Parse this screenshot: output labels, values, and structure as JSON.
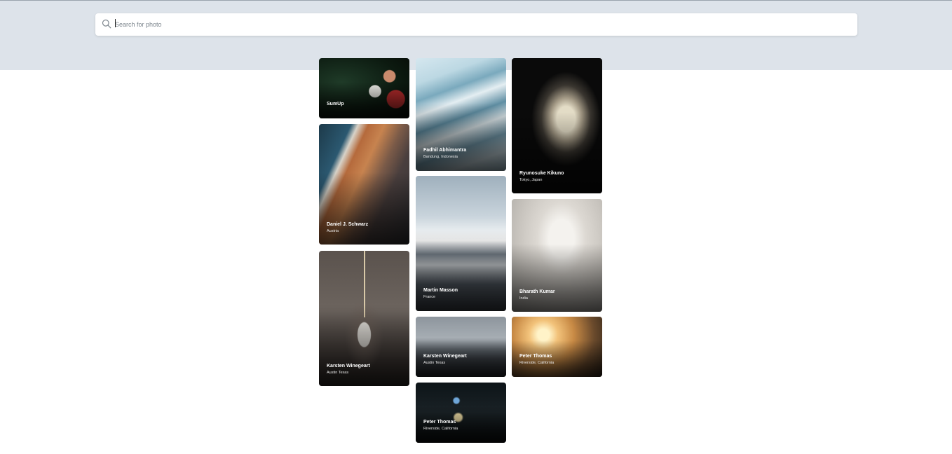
{
  "search": {
    "placeholder": "Search for photo",
    "value": ""
  },
  "photos": [
    {
      "name": "SumUp",
      "location": ""
    },
    {
      "name": "Daniel J. Schwarz",
      "location": "Austria"
    },
    {
      "name": "Karsten Winegeart",
      "location": "Austin Texas"
    },
    {
      "name": "Fadhil Abhimantra",
      "location": "Bandung, Indonesia"
    },
    {
      "name": "Martin Masson",
      "location": "France"
    },
    {
      "name": "Karsten Winegeart",
      "location": "Austin Texas"
    },
    {
      "name": "Peter Thomas",
      "location": "Riverside, California"
    },
    {
      "name": "Ryunosuke Kikuno",
      "location": "Tokyo, Japan"
    },
    {
      "name": "Bharath Kumar",
      "location": "India"
    },
    {
      "name": "Peter Thomas",
      "location": "Riverside, California"
    }
  ],
  "colors": {
    "header_band": "#dde3ea",
    "page_bg": "#ffffff"
  }
}
